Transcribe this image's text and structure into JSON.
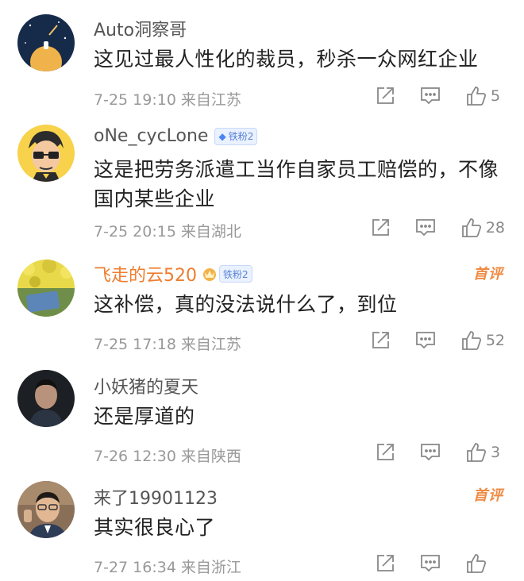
{
  "comments": [
    {
      "username": "Auto洞察哥",
      "text": "这见过最人性化的裁员，秒杀一众网红企业",
      "time": "7-25 19:10",
      "location": "来自江苏",
      "likes": "5",
      "badge": "",
      "hot": ""
    },
    {
      "username": "oNe_cycLone",
      "text": "这是把劳务派遣工当作自家员工赔偿的，不像国内某些企业",
      "time": "7-25 20:15",
      "location": "来自湖北",
      "likes": "28",
      "badge": "铁粉2",
      "hot": ""
    },
    {
      "username": "飞走的云520",
      "text": "这补偿，真的没法说什么了，到位",
      "time": "7-25 17:18",
      "location": "来自江苏",
      "likes": "52",
      "badge": "铁粉2",
      "hot": "首评"
    },
    {
      "username": "小妖猪的夏天",
      "text": "还是厚道的",
      "time": "7-26 12:30",
      "location": "来自陕西",
      "likes": "3",
      "badge": "",
      "hot": ""
    },
    {
      "username": "来了19901123",
      "text": "其实很良心了",
      "time": "7-27 16:34",
      "location": "来自浙江",
      "likes": "",
      "badge": "",
      "hot": "首评"
    }
  ],
  "colors": {
    "accent_orange": "#ee7d2f",
    "meta_gray": "#999999",
    "badge_blue": "#4d85f0"
  },
  "icons": [
    "share-icon",
    "reply-icon",
    "like-icon",
    "fan-diamond-icon",
    "fan-crown-icon"
  ]
}
